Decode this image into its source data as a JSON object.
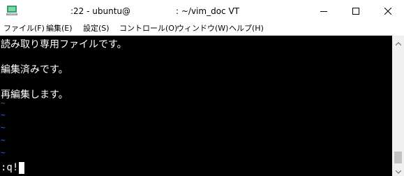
{
  "window": {
    "title_left": ":22 - ubuntu@",
    "title_right": ": ~/vim_doc VT"
  },
  "menu": [
    "ファイル(F)",
    "編集(E)",
    "設定(S)",
    "コントロール(O)",
    "ウィンドウ(W)",
    "ヘルプ(H)"
  ],
  "terminal": {
    "lines": [
      "読み取り専用ファイルです。",
      "",
      "編集済みです。",
      "",
      "再編集します。"
    ],
    "empty_line_marker": "~",
    "command_line": ":q!"
  },
  "colors": {
    "terminal_bg": "#000000",
    "terminal_fg": "#ffffff",
    "tilde": "#3c6bd8",
    "app_icon": "#2fa36a"
  },
  "icons": {
    "app": "terminal-app-icon",
    "minimize": "minimize-icon",
    "maximize": "maximize-icon",
    "close": "close-icon"
  }
}
